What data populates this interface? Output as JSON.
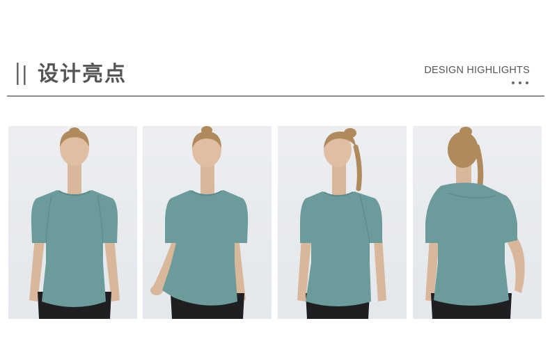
{
  "header": {
    "title": "设计亮点",
    "subtitle": "DESIGN HIGHLIGHTS"
  },
  "colors": {
    "text": "#555555",
    "divider": "#8a8a8a",
    "shirt": "#6b9b9b",
    "photo_background": "#e8eaed"
  },
  "photos": [
    {
      "view": "front"
    },
    {
      "view": "front-smiling-tugging-hem"
    },
    {
      "view": "three-quarter"
    },
    {
      "view": "back"
    }
  ]
}
